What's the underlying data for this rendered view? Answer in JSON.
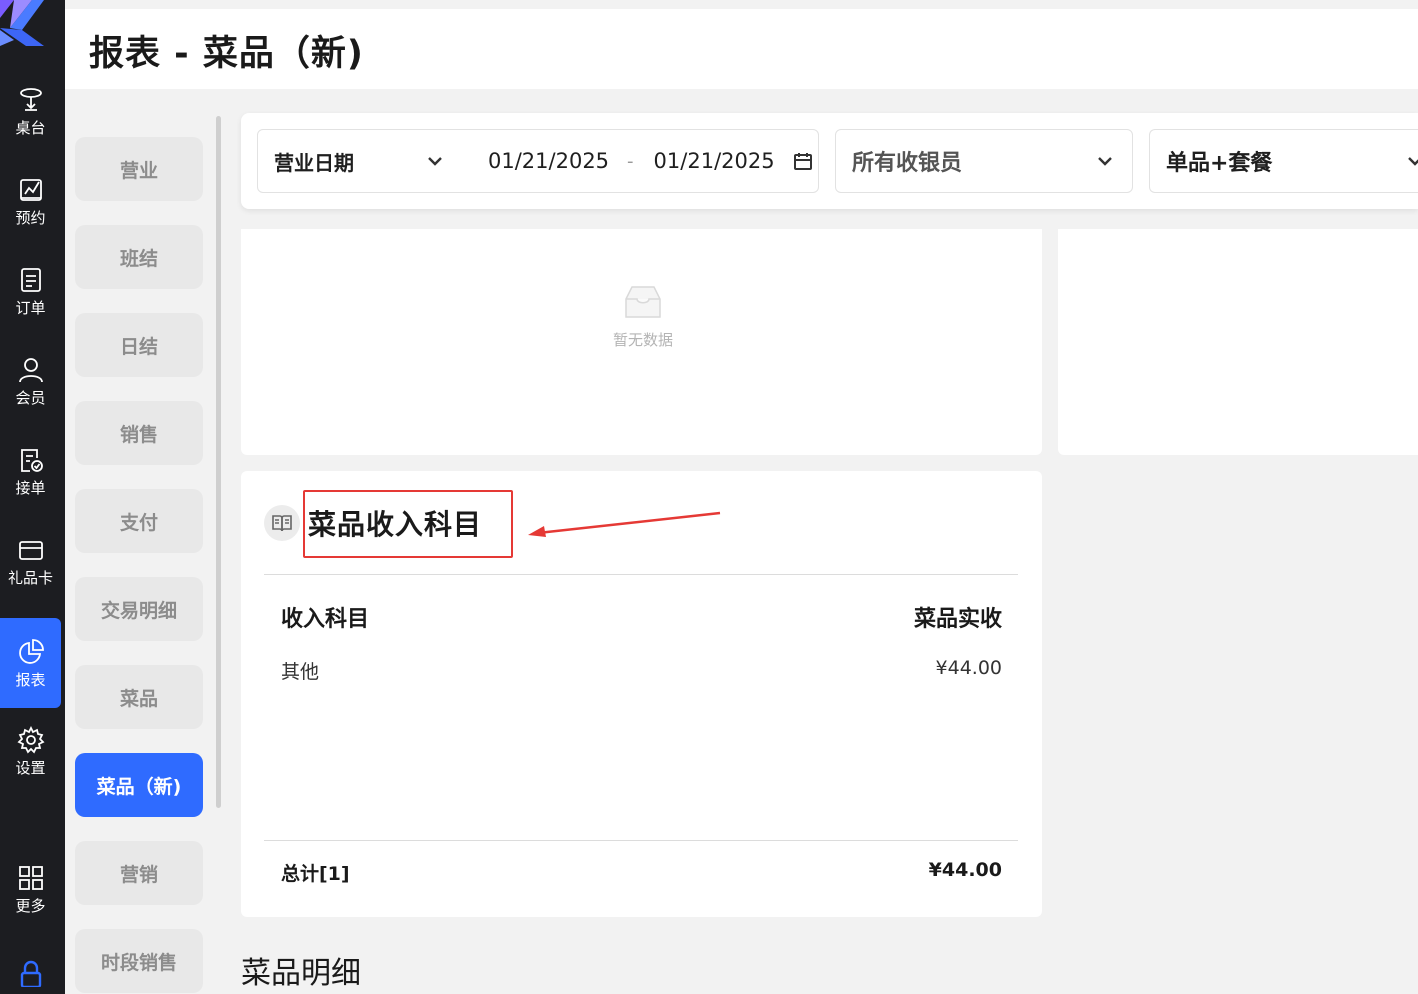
{
  "nav": {
    "items": [
      {
        "label": "桌台",
        "icon": "table-icon"
      },
      {
        "label": "预约",
        "icon": "reservation-icon"
      },
      {
        "label": "订单",
        "icon": "order-icon"
      },
      {
        "label": "会员",
        "icon": "member-icon"
      },
      {
        "label": "接单",
        "icon": "accept-order-icon"
      },
      {
        "label": "礼品卡",
        "icon": "gift-card-icon"
      },
      {
        "label": "报表",
        "icon": "report-icon",
        "active": true
      },
      {
        "label": "设置",
        "icon": "gear-icon"
      },
      {
        "label": "更多",
        "icon": "grid-icon"
      }
    ],
    "lock_icon": "lock-icon"
  },
  "header": {
    "title": "报表 - 菜品（新)"
  },
  "submenu": {
    "items": [
      {
        "label": "营业"
      },
      {
        "label": "班结"
      },
      {
        "label": "日结"
      },
      {
        "label": "销售"
      },
      {
        "label": "支付"
      },
      {
        "label": "交易明细"
      },
      {
        "label": "菜品"
      },
      {
        "label": "菜品（新)",
        "active": true
      },
      {
        "label": "营销"
      },
      {
        "label": "时段销售"
      }
    ]
  },
  "filters": {
    "date_type": "营业日期",
    "start_date": "01/21/2025",
    "date_separator": "-",
    "end_date": "01/21/2025",
    "cashier": "所有收银员",
    "item_type": "单品+套餐"
  },
  "empty_state": {
    "text": "暂无数据"
  },
  "income_section": {
    "title": "菜品收入科目",
    "columns": [
      "收入科目",
      "菜品实收"
    ],
    "rows": [
      {
        "category": "其他",
        "amount": "¥44.00"
      }
    ],
    "total_label": "总计[1]",
    "total_amount": "¥44.00"
  },
  "detail_section": {
    "title": "菜品明细"
  },
  "colors": {
    "accent": "#2f6bff",
    "nav_bg": "#1c1d21",
    "annotation": "#e53935"
  }
}
